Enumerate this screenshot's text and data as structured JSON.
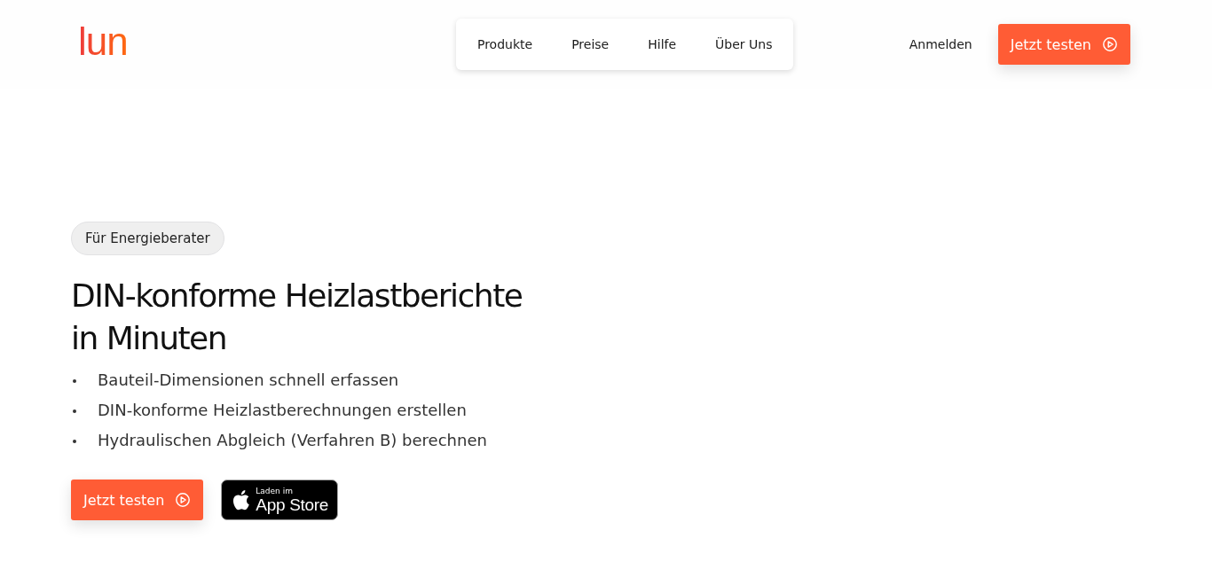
{
  "header": {
    "logo": "lun",
    "nav": [
      {
        "label": "Produkte"
      },
      {
        "label": "Preise"
      },
      {
        "label": "Hilfe"
      },
      {
        "label": "Über Uns"
      }
    ],
    "login": "Anmelden",
    "cta": "Jetzt testen"
  },
  "hero": {
    "badge": "Für Energieberater",
    "title_lines": [
      "DIN-konforme Heizlastberichte",
      "in Minuten"
    ],
    "bullets": [
      "Bauteil-Dimensionen schnell erfassen",
      "DIN-konforme Heizlastberechnungen erstellen",
      "Hydraulischen Abgleich (Verfahren B) berechnen"
    ],
    "cta": "Jetzt testen",
    "app_store": {
      "small": "Laden im",
      "large": "App Store"
    }
  }
}
